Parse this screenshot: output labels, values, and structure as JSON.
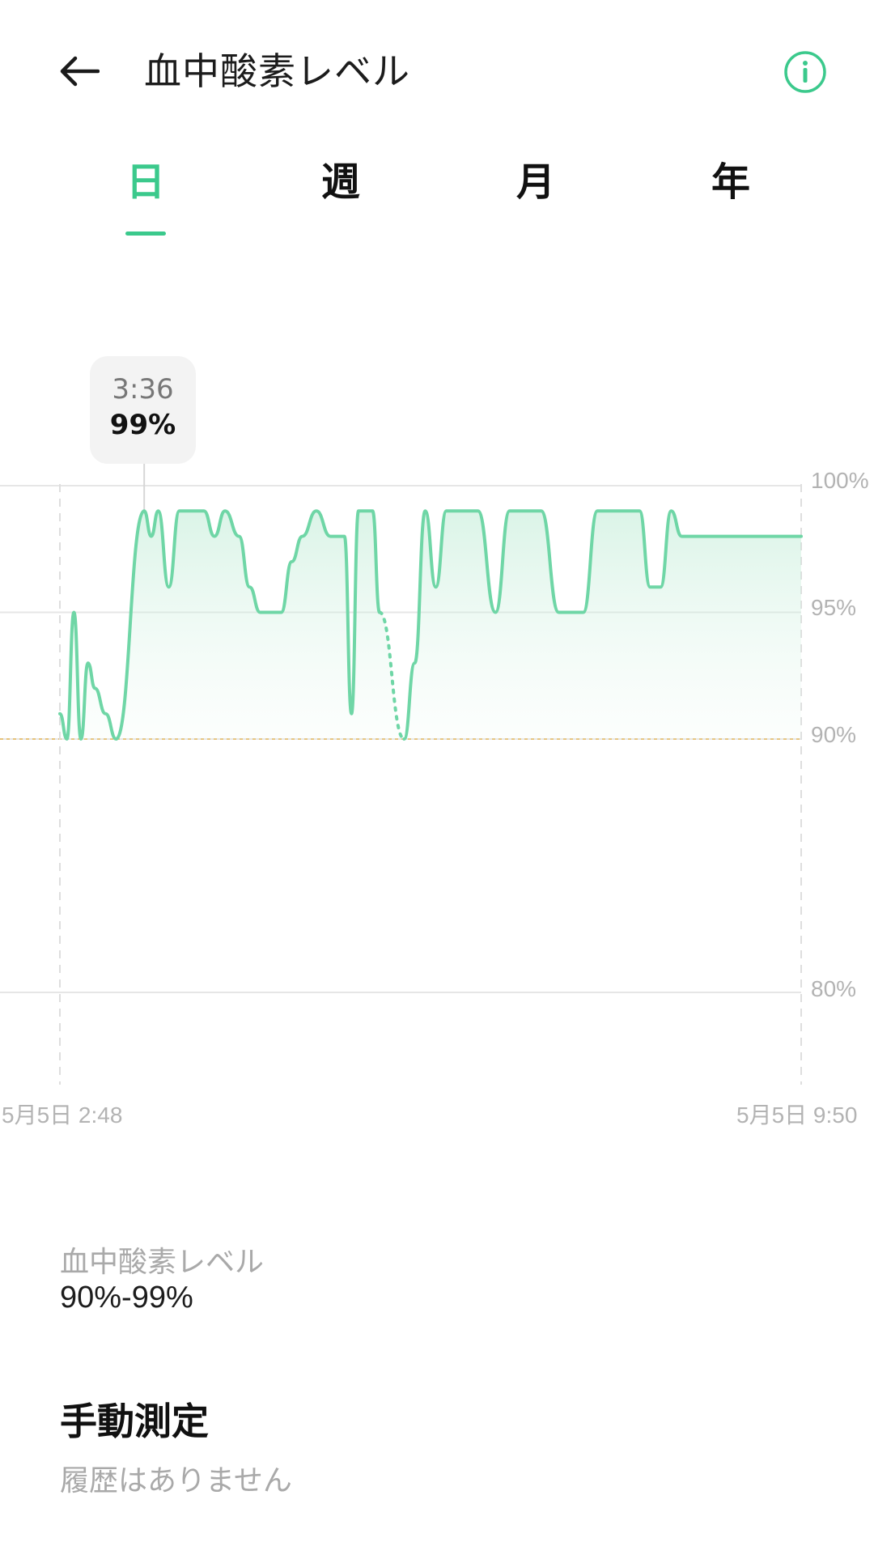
{
  "header": {
    "title": "血中酸素レベル",
    "back_icon": "arrow-left-icon",
    "info_icon": "info-circle-icon",
    "accent_color": "#3bc98c"
  },
  "tabs": [
    {
      "label": "日",
      "active": true
    },
    {
      "label": "週",
      "active": false
    },
    {
      "label": "月",
      "active": false
    },
    {
      "label": "年",
      "active": false
    }
  ],
  "chart": {
    "tooltip_time": "3:36",
    "tooltip_value": "99%",
    "y_ticks": [
      "100%",
      "95%",
      "90%",
      "80%"
    ],
    "x_start_label": "5月5日 2:48",
    "x_end_label": "5月5日 9:50"
  },
  "chart_data": {
    "type": "line",
    "x_range": [
      "5月5日 2:48",
      "5月5日 9:50"
    ],
    "ylim": [
      80,
      100
    ],
    "y_ticks": [
      100,
      95,
      90,
      80
    ],
    "threshold": 90,
    "line_color": "#6fd6a6",
    "threshold_color": "#e6c27a",
    "tooltip": {
      "time": "3:36",
      "value": 99
    },
    "series": [
      {
        "points": [
          [
            "02:48",
            91
          ],
          [
            "02:52",
            90
          ],
          [
            "02:56",
            95
          ],
          [
            "03:00",
            90
          ],
          [
            "03:04",
            93
          ],
          [
            "03:08",
            92
          ],
          [
            "03:14",
            91
          ],
          [
            "03:20",
            90
          ],
          [
            "03:36",
            99
          ],
          [
            "03:40",
            98
          ],
          [
            "03:44",
            99
          ],
          [
            "03:50",
            96
          ],
          [
            "03:56",
            99
          ],
          [
            "04:10",
            99
          ],
          [
            "04:16",
            98
          ],
          [
            "04:22",
            99
          ],
          [
            "04:30",
            98
          ],
          [
            "04:36",
            96
          ],
          [
            "04:42",
            95
          ],
          [
            "04:54",
            95
          ],
          [
            "05:00",
            97
          ],
          [
            "05:06",
            98
          ],
          [
            "05:14",
            99
          ],
          [
            "05:22",
            98
          ],
          [
            "05:30",
            98
          ],
          [
            "05:34",
            91
          ],
          [
            "05:38",
            99
          ],
          [
            "05:46",
            99
          ],
          [
            "05:50",
            95
          ],
          [
            "06:04",
            90
          ],
          [
            "06:10",
            93
          ],
          [
            "06:16",
            99
          ],
          [
            "06:22",
            96
          ],
          [
            "06:28",
            99
          ],
          [
            "06:46",
            99
          ],
          [
            "06:56",
            95
          ],
          [
            "07:04",
            99
          ],
          [
            "07:22",
            99
          ],
          [
            "07:32",
            95
          ],
          [
            "07:46",
            95
          ],
          [
            "07:54",
            99
          ],
          [
            "08:18",
            99
          ],
          [
            "08:24",
            96
          ],
          [
            "08:30",
            96
          ],
          [
            "08:36",
            99
          ],
          [
            "08:42",
            98
          ],
          [
            "09:50",
            98
          ]
        ]
      }
    ]
  },
  "summary": {
    "label": "血中酸素レベル",
    "value": "90%-99%"
  },
  "manual": {
    "title": "手動測定",
    "empty_text": "履歴はありません"
  }
}
